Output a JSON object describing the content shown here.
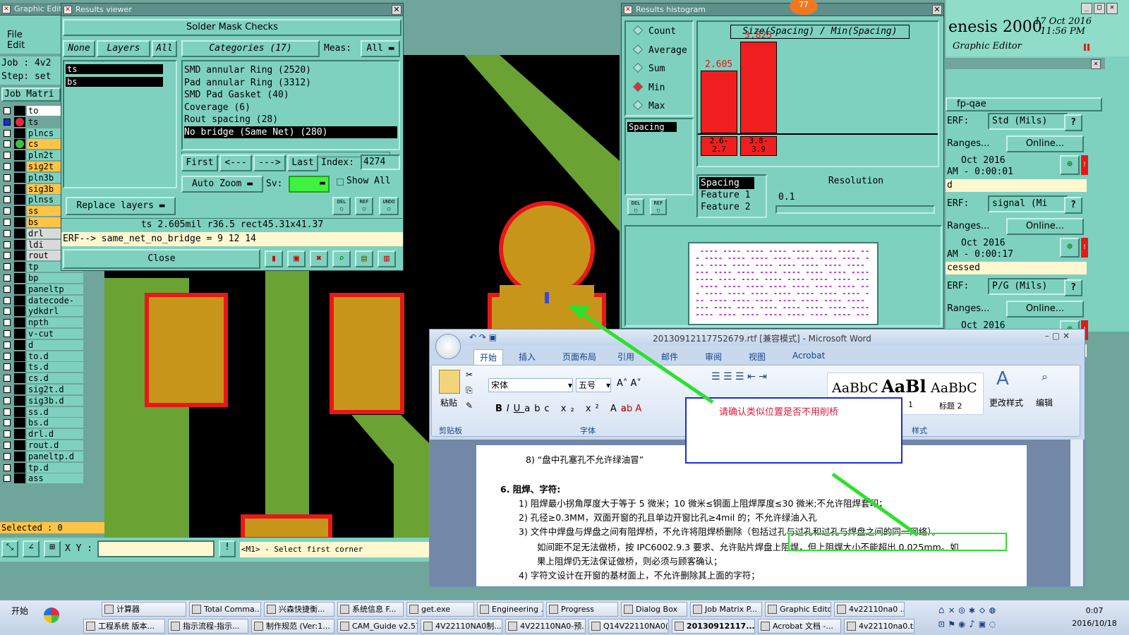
{
  "graphic_editor": {
    "title": "Graphic Edit",
    "menu": [
      "File",
      "Edit"
    ],
    "job_label": "Job : 4v2",
    "step_label": "Step: set",
    "job_matrix_tab": "Job Matri",
    "layers": [
      {
        "name": "to",
        "color": "#ffffff"
      },
      {
        "name": "ts",
        "color": "#6fa59b",
        "dot": "#e8283c",
        "selected": true
      },
      {
        "name": "plncs",
        "color": "#7fd1bf"
      },
      {
        "name": "cs",
        "color": "#ffc445",
        "dot": "#3fbf3f"
      },
      {
        "name": "pln2t",
        "color": "#7fd1bf"
      },
      {
        "name": "sig2t",
        "color": "#ffc445"
      },
      {
        "name": "pln3b",
        "color": "#7fd1bf"
      },
      {
        "name": "sig3b",
        "color": "#ffc445"
      },
      {
        "name": "plnss",
        "color": "#7fd1bf"
      },
      {
        "name": "ss",
        "color": "#ffc445"
      },
      {
        "name": "bs",
        "color": "#ffc445"
      },
      {
        "name": "drl",
        "color": "#d9d9d9"
      },
      {
        "name": "ldi",
        "color": "#d9d9d9"
      },
      {
        "name": "rout",
        "color": "#d9d9d9"
      },
      {
        "name": "tp",
        "color": "#7fd1bf"
      },
      {
        "name": "bp",
        "color": "#7fd1bf"
      },
      {
        "name": "paneltp",
        "color": "#7fd1bf"
      },
      {
        "name": "datecode-ss",
        "color": "#7fd1bf"
      },
      {
        "name": "ydkdrl",
        "color": "#7fd1bf"
      },
      {
        "name": "npth",
        "color": "#7fd1bf"
      },
      {
        "name": "v-cut",
        "color": "#7fd1bf"
      },
      {
        "name": "d",
        "color": "#7fd1bf"
      },
      {
        "name": "to.d",
        "color": "#7fd1bf"
      },
      {
        "name": "ts.d",
        "color": "#7fd1bf"
      },
      {
        "name": "cs.d",
        "color": "#7fd1bf"
      },
      {
        "name": "sig2t.d",
        "color": "#7fd1bf"
      },
      {
        "name": "sig3b.d",
        "color": "#7fd1bf"
      },
      {
        "name": "ss.d",
        "color": "#7fd1bf"
      },
      {
        "name": "bs.d",
        "color": "#7fd1bf"
      },
      {
        "name": "drl.d",
        "color": "#7fd1bf"
      },
      {
        "name": "rout.d",
        "color": "#7fd1bf"
      },
      {
        "name": "paneltp.d",
        "color": "#7fd1bf"
      },
      {
        "name": "tp.d",
        "color": "#7fd1bf"
      },
      {
        "name": "ass",
        "color": "#7fd1bf"
      }
    ],
    "selected_label": "Selected : 0",
    "xy_label": "X Y :",
    "prompt": "<M1> - Select first corner"
  },
  "results_viewer": {
    "title": "Results viewer",
    "header": "Solder Mask Checks",
    "none_btn": "None",
    "layers_btn": "Layers",
    "all_btn": "All",
    "categories_btn": "Categories (17)",
    "meas_label": "Meas:",
    "meas_value": "All",
    "layer_items": [
      "ts",
      "bs"
    ],
    "categories": [
      "SMD annular Ring (2520)",
      "Pad annular Ring (3312)",
      "SMD Pad Gasket (40)",
      "Coverage (6)",
      "Rout spacing (28)",
      "No bridge (Same Net) (280)"
    ],
    "first_btn": "First",
    "prev_btn": "<---",
    "next_btn": "--->",
    "last_btn": "Last",
    "index_label": "Index:",
    "index_value": "4274",
    "auto_zoom": "Auto Zoom",
    "sv_label": "Sv:",
    "show_all": "Show All",
    "replace_layers": "Replace layers",
    "del_label": "DEL",
    "ref_label": "REF",
    "undo_label": "UNDO",
    "measure_line": "ts 2.605mil  r36.5  rect45.31x41.37",
    "erf_line": "ERF--> same_net_no_bridge = 9 12 14",
    "close_btn": "Close"
  },
  "results_histogram": {
    "title": "Results histogram",
    "badge": "77",
    "options": [
      "Count",
      "Average",
      "Sum",
      "Min",
      "Max"
    ],
    "selected_option": "Min",
    "list_item": "Spacing",
    "chart_title": "Size(Spacing) / Min(Spacing)",
    "bars": [
      {
        "value": "2.605",
        "range": "2.6-\n2.7",
        "frac": 0.681
      },
      {
        "value": "3.825",
        "range": "3.8-\n3.9",
        "frac": 1.0
      }
    ],
    "spacing_items": [
      "Spacing",
      "Feature 1",
      "Feature 2"
    ],
    "resolution_label": "Resolution",
    "resolution_value": "0.1",
    "del_label": "DEL",
    "ref_label": "REF"
  },
  "genesis": {
    "app_title": "enesis 2000",
    "date": "17 Oct 2016",
    "time": "11:56 PM",
    "subtitle": "Graphic Editor",
    "panel_title": "fp-qae",
    "groups": [
      {
        "erf_label": "ERF:",
        "erf_value": "Std (Mils)",
        "ranges": "Ranges...",
        "online": "Online...",
        "date": "Oct  2016",
        "time": "AM - 0:00:01",
        "status": "d"
      },
      {
        "erf_label": "ERF:",
        "erf_value": "signal (Mi",
        "ranges": "Ranges...",
        "online": "Online...",
        "date": "Oct  2016",
        "time": "AM - 0:00:17",
        "status": "cessed"
      },
      {
        "erf_label": "ERF:",
        "erf_value": "P/G (Mils)",
        "ranges": "Ranges...",
        "online": "Online...",
        "date": "Oct  2016",
        "time": "",
        "status": ""
      }
    ]
  },
  "word": {
    "title": "20130912117752679.rtf [兼容模式] - Microsoft Word",
    "tabs": [
      "开始",
      "插入",
      "页面布局",
      "引用",
      "邮件",
      "审阅",
      "视图",
      "Acrobat"
    ],
    "clipboard": "剪贴板",
    "paste": "粘贴",
    "font_name": "宋体",
    "font_size": "五号",
    "font_group": "字体",
    "styles_group": "样式",
    "style1": "AaBbC",
    "style2": "AaBl",
    "style3": "AaBbC",
    "style3_label": "标题 2",
    "style2_label": "1",
    "change_styles": "更改样式",
    "edit": "编辑",
    "comment": "请确认类似位置是否不用削桥",
    "doc_lines": [
      "8) “盘中孔塞孔不允许绿油冒”",
      "6.   阻焊、字符:",
      "1)  阻焊最小拐角厚度大于等于 5 微米；10 微米≤铜面上阻焊厚度≤30 微米;不允许阻焊套印；",
      "2)  孔径≥0.3MM，双面开窗的孔且单边开窗比孔≥4mil 的；不允许绿油入孔",
      "3)  文件中焊盘与焊盘之间有阻焊桥，不允许将阻焊桥删除（包括过孔与过孔和过孔与焊盘之间的同一网络）。",
      "如间距不足无法做桥，按 IPC6002.9.3 要求、允许贴片焊盘上阻焊，但上阻焊大小不能超出 0.025mm。如",
      "果上阻焊仍无法保证做桥，则必须与顾客确认；",
      "4)  字符文设计在开窗的基材面上，不允许删除其上面的字符；"
    ]
  },
  "taskbar": {
    "start": "开始",
    "row1": [
      "计算器",
      "Total Comma...",
      "兴森快捷衡...",
      "系统信息 F...",
      "get.exe",
      "Engineering ...",
      "Progress",
      "Dialog Box",
      "Job Matrix P...",
      "Graphic Edito...",
      "4v22110na0 ..."
    ],
    "row2": [
      "工程系统  版本...",
      "指示流程-指示...",
      "制作规范 (Ver:1...",
      "CAM_Guide v2.57",
      "4V22110NA0制...",
      "4V22110NA0-预...",
      "Q14V22110NA0(...",
      "20130912117...",
      "Acrobat 文档 -...",
      "4v22110na0.txt ..."
    ],
    "clock_time": "0:07",
    "clock_date": "2016/10/18"
  }
}
